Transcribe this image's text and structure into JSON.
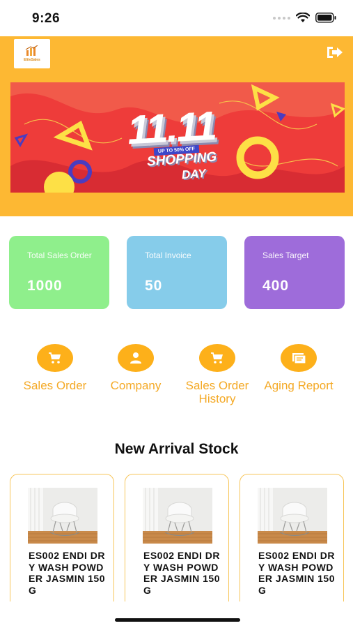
{
  "status_bar": {
    "time": "9:26"
  },
  "header": {
    "logo_icon": "store-logo-icon",
    "logo_text": "EliteSales",
    "logout_icon": "logout-icon",
    "background_color": "#fdb833"
  },
  "banner": {
    "big_text": "11.11",
    "tag_text": "UP TO 50% OFF",
    "line1": "SHOPPING",
    "line2": "DAY"
  },
  "stats": [
    {
      "label": "Total Sales Order",
      "value": "1000",
      "color": "#8fef8c"
    },
    {
      "label": "Total Invoice",
      "value": "50",
      "color": "#86ccea"
    },
    {
      "label": "Sales Target",
      "value": "400",
      "color": "#9e6cda"
    }
  ],
  "menu": [
    {
      "label": "Sales Order",
      "icon": "cart-icon"
    },
    {
      "label": "Company",
      "icon": "person-icon"
    },
    {
      "label": "Sales Order History",
      "icon": "cart-icon"
    },
    {
      "label": "Aging Report",
      "icon": "report-icon"
    }
  ],
  "accent_color": "#fdb01a",
  "section_title": "New Arrival Stock",
  "products": [
    {
      "name": "ES002 ENDI DRY WASH POWDER JASMIN 150G",
      "image": "chair-photo"
    },
    {
      "name": "ES002 ENDI DRY WASH POWDER JASMIN 150G",
      "image": "chair-photo"
    },
    {
      "name": "ES002 ENDI DRY WASH POWDER JASMIN 150G",
      "image": "chair-photo"
    }
  ]
}
